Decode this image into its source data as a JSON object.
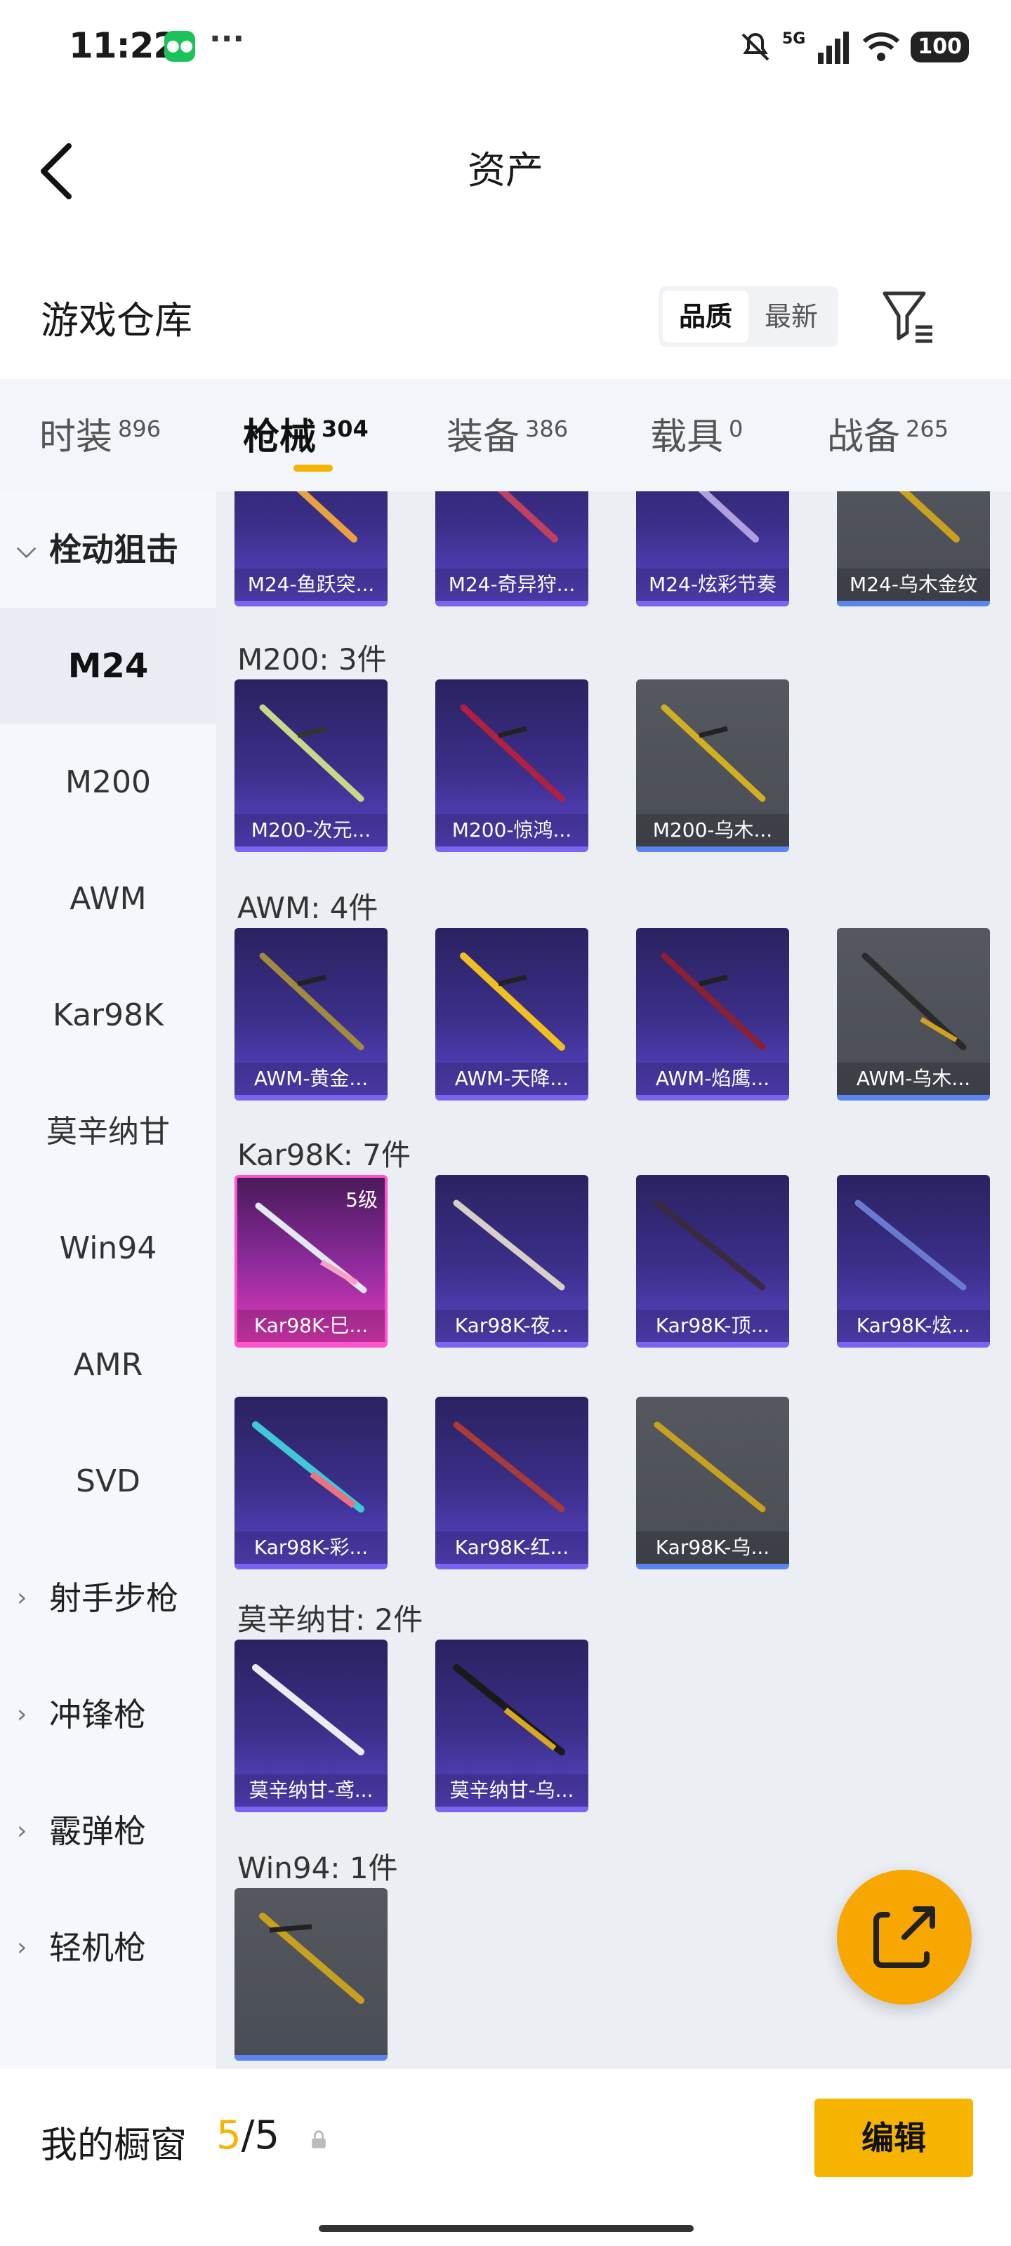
{
  "status": {
    "time": "11:22",
    "network": "5G",
    "battery": "100"
  },
  "header": {
    "title": "资产"
  },
  "warehouse": {
    "title": "游戏仓库",
    "sort_options": [
      "品质",
      "最新"
    ],
    "active_sort": "品质"
  },
  "tabs": [
    {
      "label": "时装",
      "count": "896"
    },
    {
      "label": "枪械",
      "count": "304"
    },
    {
      "label": "装备",
      "count": "386"
    },
    {
      "label": "载具",
      "count": "0"
    },
    {
      "label": "战备",
      "count": "265"
    }
  ],
  "sidebar": {
    "open_group": "栓动狙击",
    "items": [
      "M24",
      "M200",
      "AWM",
      "Kar98K",
      "莫辛纳甘",
      "Win94",
      "AMR",
      "SVD"
    ],
    "groups": [
      "射手步枪",
      "冲锋枪",
      "霰弹枪",
      "轻机枪"
    ]
  },
  "sections": {
    "m24": {
      "cards": [
        "M24-鱼跃突...",
        "M24-奇异狩...",
        "M24-炫彩节奏",
        "M24-乌木金纹"
      ]
    },
    "m200": {
      "title": "M200: 3件",
      "cards": [
        "M200-次元...",
        "M200-惊鸿...",
        "M200-乌木..."
      ]
    },
    "awm": {
      "title": "AWM: 4件",
      "cards": [
        "AWM-黄金...",
        "AWM-天降...",
        "AWM-焰鹰...",
        "AWM-乌木..."
      ]
    },
    "kar98k": {
      "title": "Kar98K: 7件",
      "level": "5级",
      "cards": [
        "Kar98K-巳...",
        "Kar98K-夜...",
        "Kar98K-顶...",
        "Kar98K-炫...",
        "Kar98K-彩...",
        "Kar98K-红...",
        "Kar98K-乌..."
      ]
    },
    "mosin": {
      "title": "莫辛纳甘: 2件",
      "cards": [
        "莫辛纳甘-鸢...",
        "莫辛纳甘-乌..."
      ]
    },
    "win94": {
      "title": "Win94: 1件"
    }
  },
  "bottom": {
    "showcase_label": "我的橱窗",
    "count_current": "5",
    "count_total": "/5",
    "edit_label": "编辑"
  }
}
